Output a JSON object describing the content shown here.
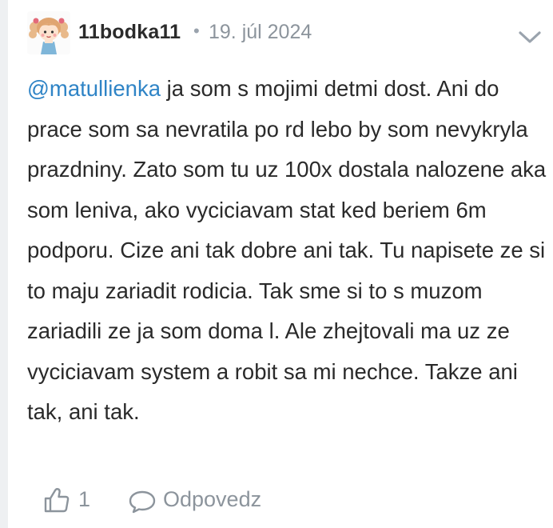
{
  "comment": {
    "author": "11bodka11",
    "separator": "•",
    "date": "19. júl 2024",
    "mention": "@matullienka",
    "text": " ja som s mojimi detmi dost. Ani do prace som sa nevratila po rd lebo by som nevykryla prazdniny. Zato som tu uz 100x dostala nalozene aka som leniva, ako vyciciavam stat ked beriem 6m podporu. Cize ani tak dobre ani tak. Tu napisete ze si to maju zariadit rodicia. Tak sme si to s muzom zariadili ze ja som doma l. Ale zhejtovali ma uz ze vyciciavam system a robit sa mi nechce. Takze ani tak, ani tak.",
    "likes": "1",
    "reply_label": "Odpovedz"
  },
  "icons": {
    "avatar": "avatar-girl-illustration",
    "menu": "chevron-down-icon",
    "like": "thumbs-up-icon",
    "reply": "speech-bubble-icon"
  },
  "colors": {
    "mention": "#2f84c6",
    "muted": "#8c949c",
    "text": "#2a2a2a"
  }
}
